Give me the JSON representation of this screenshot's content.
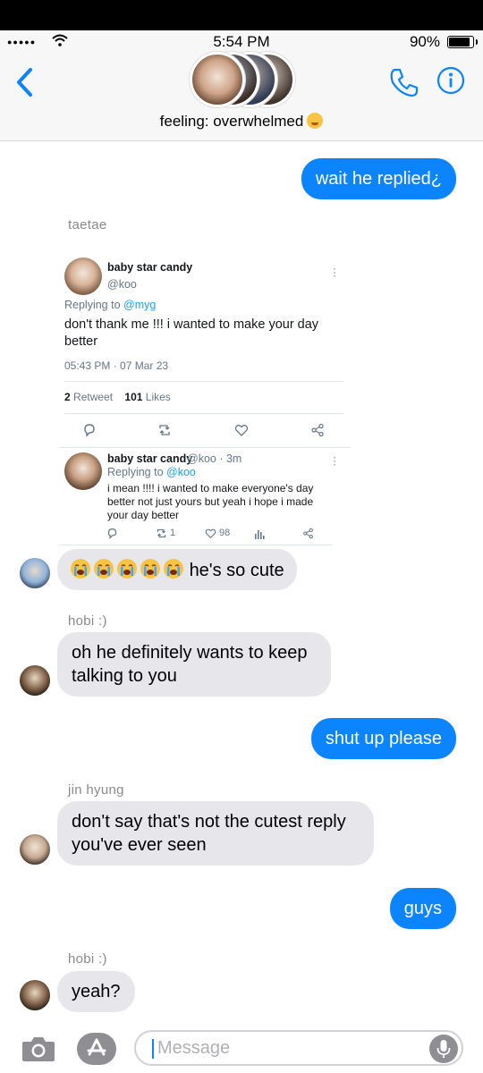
{
  "status": {
    "time": "5:54 PM",
    "battery": "90%"
  },
  "header": {
    "group_name": "feeling: overwhelmed"
  },
  "colors": {
    "accent": "#0b84fe",
    "incoming": "#e6e6eb",
    "twitter_blue": "#1da1f2"
  },
  "icons": [
    "back-chevron-icon",
    "phone-icon",
    "info-icon",
    "camera-icon",
    "app-store-icon",
    "microphone-icon"
  ],
  "messages": [
    {
      "type": "out",
      "text": "wait he replied¿"
    },
    {
      "sender": "taetae"
    },
    {
      "type": "in",
      "text": "he's so cute"
    },
    {
      "sender": "hobi :)"
    },
    {
      "type": "in",
      "text": "oh he definitely wants to keep talking to you"
    },
    {
      "type": "out",
      "text": "shut up please"
    },
    {
      "sender": "jin hyung"
    },
    {
      "type": "in",
      "text": "don't say that's not the cutest reply you've ever seen"
    },
    {
      "type": "out",
      "text": "guys"
    },
    {
      "sender": "hobi :)"
    },
    {
      "type": "in",
      "text": "yeah?"
    }
  ],
  "tweet": {
    "main": {
      "name": "baby star candy",
      "handle": "@koo",
      "replying_prefix": "Replying to ",
      "replying_to": "@myg",
      "text": "don't thank me !!! i wanted to make your day better",
      "timestamp": "05:43 PM · 07 Mar 23",
      "retweets": "2",
      "retweets_label": "Retweet",
      "likes": "101",
      "likes_label": "Likes"
    },
    "reply": {
      "name": "baby star candy",
      "handle_time": "@koo · 3m",
      "replying_prefix": "Replying to ",
      "replying_to": "@koo",
      "text": "i mean !!!! i wanted to make everyone's day better not just yours but yeah i hope i made your day better",
      "retweets": "1",
      "likes": "98"
    }
  },
  "input": {
    "placeholder": "Message"
  }
}
